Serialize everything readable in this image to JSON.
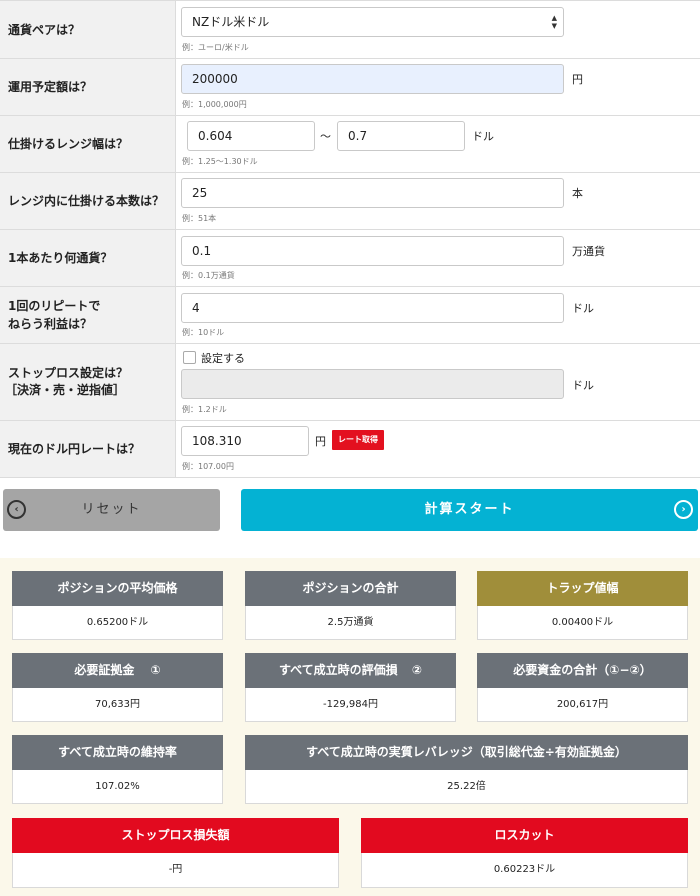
{
  "form": {
    "pair": {
      "label": "通貨ペアは？",
      "value": "NZドル米ドル",
      "hint": "例：ユーロ/米ドル"
    },
    "amount": {
      "label": "運用予定額は？",
      "value": "200000",
      "unit": "円",
      "hint": "例：1,000,000円"
    },
    "range": {
      "label": "仕掛けるレンジ幅は？",
      "low": "0.604",
      "sep": "〜",
      "high": "0.7",
      "unit": "ドル",
      "hint": "例：1.25〜1.30ドル"
    },
    "count": {
      "label": "レンジ内に仕掛ける本数は？",
      "value": "25",
      "unit": "本",
      "hint": "例：51本"
    },
    "per": {
      "label": "1本あたり何通貨？",
      "value": "0.1",
      "unit": "万通貨",
      "hint": "例：0.1万通貨"
    },
    "profit": {
      "label1": "1回のリピートで",
      "label2": "ねらう利益は？",
      "value": "4",
      "unit": "ドル",
      "hint": "例：10ドル"
    },
    "stop": {
      "label1": "ストップロス設定は？",
      "label2": "［決済・売・逆指値］",
      "checkbox": "設定する",
      "value": "",
      "unit": "ドル",
      "hint": "例：1.2ドル"
    },
    "rate": {
      "label": "現在のドル円レートは？",
      "value": "108.310",
      "unit": "円",
      "button": "レート取得",
      "hint": "例：107.00円"
    }
  },
  "buttons": {
    "reset": "リセット",
    "calc": "計算スタート"
  },
  "results": {
    "avg_price": {
      "title": "ポジションの平均価格",
      "value": "0.65200ドル"
    },
    "total_pos": {
      "title": "ポジションの合計",
      "value": "2.5万通貨"
    },
    "trap": {
      "title": "トラップ値幅",
      "value": "0.00400ドル"
    },
    "margin": {
      "title": "必要証拠金",
      "mark": "①",
      "value": "70,633円"
    },
    "loss": {
      "title": "すべて成立時の評価損",
      "mark": "②",
      "value": "-129,984円"
    },
    "funds": {
      "title": "必要資金の合計（①−②）",
      "value": "200,617円"
    },
    "maint": {
      "title": "すべて成立時の維持率",
      "value": "107.02%"
    },
    "leverage": {
      "title": "すべて成立時の実質レバレッジ（取引総代金÷有効証拠金）",
      "value": "25.22倍"
    },
    "stoploss": {
      "title": "ストップロス損失額",
      "value": "-円"
    },
    "losscut": {
      "title": "ロスカット",
      "value": "0.60223ドル"
    }
  },
  "colors": {
    "accent": "#04b2d3",
    "header_gray": "#6b7178",
    "header_gold": "#a08e3a",
    "header_red": "#e20a1f"
  },
  "icons": {
    "reset": "chevron-left-circle-icon",
    "calc": "chevron-right-circle-icon",
    "select": "select-arrows-icon"
  }
}
